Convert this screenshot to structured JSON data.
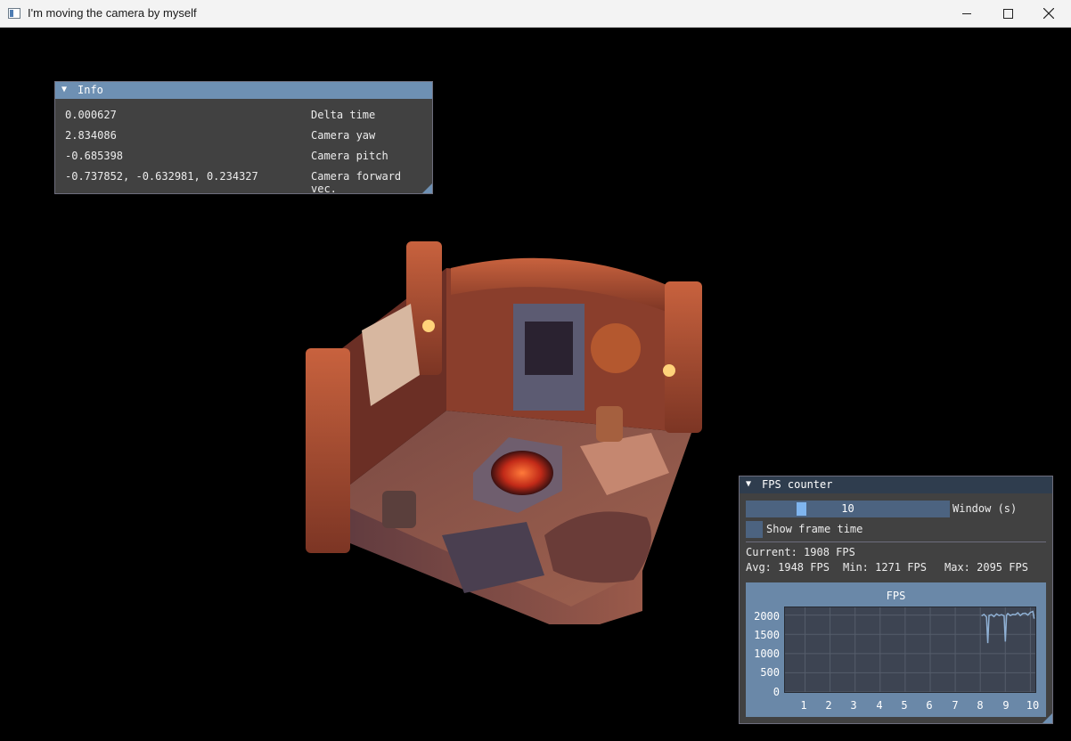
{
  "window": {
    "title": "I'm moving the camera by myself"
  },
  "info_panel": {
    "title": "Info",
    "rows": [
      {
        "value": "0.000627",
        "label": "Delta time"
      },
      {
        "value": "2.834086",
        "label": "Camera yaw"
      },
      {
        "value": "-0.685398",
        "label": "Camera pitch"
      },
      {
        "value": "-0.737852, -0.632981, 0.234327",
        "label": "Camera forward vec."
      }
    ]
  },
  "fps_panel": {
    "title": "FPS counter",
    "slider_value": "10",
    "slider_level": 0.26,
    "slider_label": "Window (s)",
    "checkbox_label": "Show frame time",
    "checkbox_checked": false,
    "current": "Current: 1908 FPS",
    "avg": "Avg: 1948 FPS",
    "min": "Min: 1271 FPS",
    "max": "Max: 2095 FPS"
  },
  "chart_data": {
    "type": "line",
    "title": "FPS",
    "xlabel": "",
    "ylabel": "",
    "xlim": [
      0.2,
      10.2
    ],
    "ylim": [
      0,
      2200
    ],
    "x_ticks": [
      "1",
      "2",
      "3",
      "4",
      "5",
      "6",
      "7",
      "8",
      "9",
      "10"
    ],
    "y_ticks": [
      "2000",
      "1500",
      "1000",
      "500",
      "0"
    ],
    "grid": true,
    "series": [
      {
        "color": "#8fb0d4",
        "x": [
          8.05,
          8.15,
          8.25,
          8.3,
          8.35,
          8.45,
          8.55,
          8.65,
          8.75,
          8.85,
          8.95,
          9.0,
          9.05,
          9.1,
          9.2,
          9.3,
          9.4,
          9.5,
          9.6,
          9.7,
          9.8,
          9.9,
          10.0,
          10.1,
          10.15
        ],
        "y": [
          1980,
          2020,
          1950,
          1271,
          1990,
          2010,
          1960,
          2030,
          1990,
          2010,
          1980,
          1310,
          2000,
          2040,
          1990,
          2020,
          2010,
          2060,
          1990,
          2040,
          2050,
          2000,
          2070,
          2095,
          1908
        ]
      }
    ]
  }
}
